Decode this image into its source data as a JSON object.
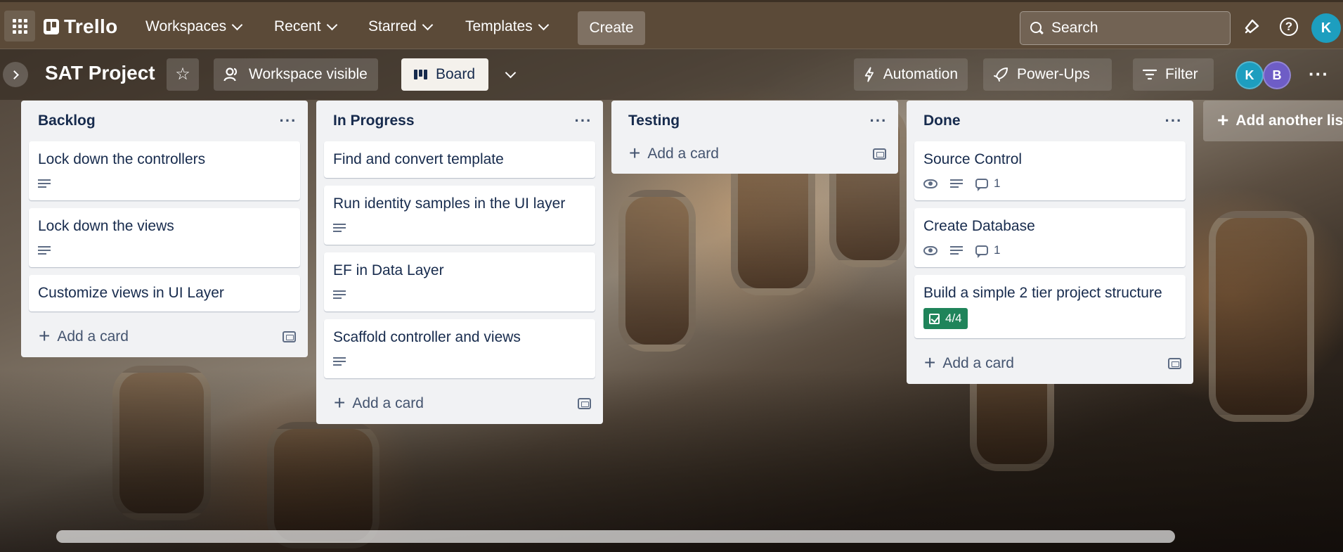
{
  "header": {
    "logo_text": "Trello",
    "nav": [
      {
        "label": "Workspaces"
      },
      {
        "label": "Recent"
      },
      {
        "label": "Starred"
      },
      {
        "label": "Templates"
      }
    ],
    "create_label": "Create",
    "search_placeholder": "Search",
    "user_initial": "K"
  },
  "board": {
    "title": "SAT Project",
    "visibility_label": "Workspace visible",
    "view_label": "Board",
    "automation_label": "Automation",
    "powerups_label": "Power-Ups",
    "filter_label": "Filter",
    "members": [
      {
        "initial": "K",
        "color": "#1d9ebf"
      },
      {
        "initial": "B",
        "color": "#6e5dc6"
      }
    ]
  },
  "lists": [
    {
      "title": "Backlog",
      "cards": [
        {
          "title": "Lock down the controllers",
          "description": true
        },
        {
          "title": "Lock down the views",
          "description": true
        },
        {
          "title": "Customize views in UI Layer",
          "description": false
        }
      ],
      "add_card_label": "Add a card"
    },
    {
      "title": "In Progress",
      "cards": [
        {
          "title": "Find and convert template",
          "description": false
        },
        {
          "title": "Run identity samples in the UI layer",
          "description": true
        },
        {
          "title": "EF in Data Layer",
          "description": true
        },
        {
          "title": "Scaffold controller and views",
          "description": true
        }
      ],
      "add_card_label": "Add a card"
    },
    {
      "title": "Testing",
      "cards": [],
      "add_card_label": "Add a card"
    },
    {
      "title": "Done",
      "cards": [
        {
          "title": "Source Control",
          "watching": true,
          "description": true,
          "comments": "1"
        },
        {
          "title": "Create Database",
          "watching": true,
          "description": true,
          "comments": "1"
        },
        {
          "title": "Build a simple 2 tier project structure",
          "checklist": "4/4"
        }
      ],
      "add_card_label": "Add a card"
    }
  ],
  "add_list_label": "Add another list",
  "colors": {
    "header_bg": "#5b4a38",
    "list_bg": "#f1f2f4",
    "checklist_complete": "#1f845a"
  }
}
